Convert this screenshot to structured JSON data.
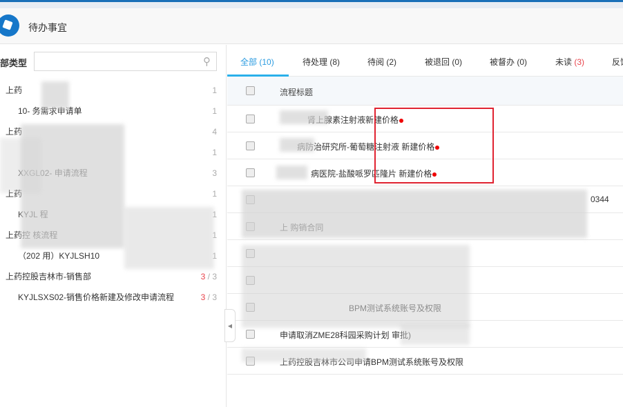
{
  "header": {
    "title": "待办事宜"
  },
  "sidebar": {
    "label": "部类型",
    "search_placeholder": "",
    "items": [
      {
        "label": "上药",
        "count": "1",
        "level": 1
      },
      {
        "label": "10-  务需求申请单",
        "count": "1",
        "level": 2
      },
      {
        "label": "上药",
        "count": "4",
        "level": 1
      },
      {
        "label": "",
        "count": "1",
        "level": 2
      },
      {
        "label": "XXGL02-   申请流程",
        "count": "3",
        "level": 2
      },
      {
        "label": "上药",
        "count": "1",
        "level": 1
      },
      {
        "label": "KYJL   程",
        "count": "1",
        "level": 2
      },
      {
        "label": "上药控   核流程",
        "count": "1",
        "level": 1
      },
      {
        "label": "（202   用）KYJLSH10",
        "count": "1",
        "level": 2
      },
      {
        "label": "上药控股吉林市-销售部",
        "count_red": "3",
        "count": "3",
        "level": 1
      },
      {
        "label": "KYJLSXS02-销售价格新建及修改申请流程",
        "count_red": "3",
        "count": "3",
        "level": 2
      }
    ]
  },
  "tabs": [
    {
      "label": "全部",
      "count": "(10)",
      "active": true
    },
    {
      "label": "待处理",
      "count": "(8)"
    },
    {
      "label": "待阅",
      "count": "(2)"
    },
    {
      "label": "被退回",
      "count": "(0)"
    },
    {
      "label": "被督办",
      "count": "(0)"
    },
    {
      "label": "未读",
      "count": "(3)",
      "red": true
    },
    {
      "label": "反馈"
    }
  ],
  "table": {
    "header": "流程标题",
    "rows": [
      {
        "title": "肾上腺素注射液新建价格",
        "unread": true
      },
      {
        "title": "病防治研究所-葡萄糖注射液 新建价格",
        "unread": true
      },
      {
        "title": "病医院-盐酸哌罗匹隆片 新建价格",
        "unread": true
      },
      {
        "title": "0344"
      },
      {
        "title": "上  购销合同"
      },
      {
        "title": ""
      },
      {
        "title": ""
      },
      {
        "title": "BPM测试系统账号及权限"
      },
      {
        "title": "申请取消ZME28科园采购计划   审批)"
      },
      {
        "title": "上药控股吉林市公司申请BPM测试系统账号及权限"
      }
    ]
  }
}
